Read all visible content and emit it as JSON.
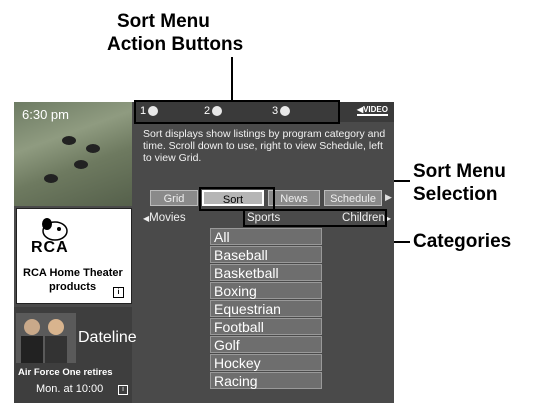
{
  "callouts": {
    "top_line1": "Sort Menu",
    "top_line2": "Action Buttons",
    "right1_line1": "Sort Menu",
    "right1_line2": "Selection",
    "right2": "Categories"
  },
  "screen": {
    "time": "6:30 pm",
    "logo": "VIDEO",
    "action_buttons": [
      "1",
      "2",
      "3"
    ],
    "info": "Sort displays show listings by program category and time. Scroll down to use, right to view Schedule, left to view Grid.",
    "tabs": [
      "Grid",
      "Sort",
      "News",
      "Schedule"
    ],
    "categories": {
      "left": "Movies",
      "center": "Sports",
      "right": "Children"
    },
    "sort_items": [
      "All",
      "Baseball",
      "Basketball",
      "Boxing",
      "Equestrian",
      "Football",
      "Golf",
      "Hockey",
      "Racing"
    ]
  },
  "ads": {
    "rca_brand": "RCA",
    "rca_line1": "RCA Home Theater",
    "rca_line2": "products",
    "dateline_title": "Dateline",
    "dateline_line1": "Air Force One retires",
    "dateline_line2": "Mon. at 10:00"
  },
  "colors": {
    "screen_bg": "#4a4a4a",
    "accent_text": "#ffffff",
    "callout_text": "#000000"
  }
}
